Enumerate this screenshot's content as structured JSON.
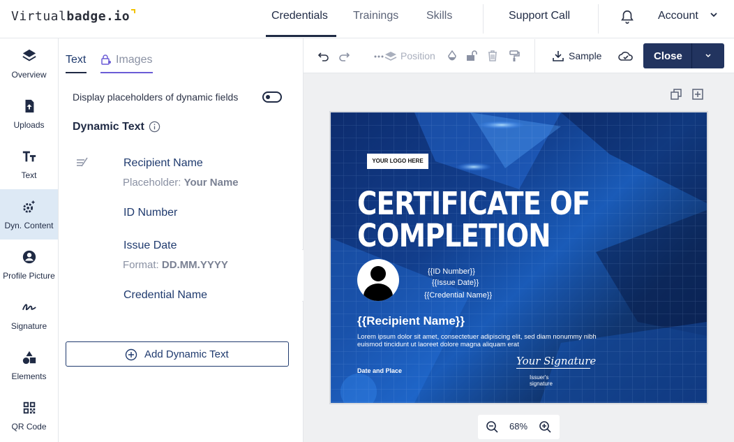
{
  "header": {
    "logo_light": "Virtual",
    "logo_bold": "badge.io",
    "nav": [
      "Credentials",
      "Trainings",
      "Skills"
    ],
    "support_label": "Support Call",
    "account_label": "Account"
  },
  "sidebar": {
    "items": [
      {
        "label": "Overview",
        "icon": "layers-icon"
      },
      {
        "label": "Uploads",
        "icon": "upload-icon"
      },
      {
        "label": "Text",
        "icon": "text-icon"
      },
      {
        "label": "Dyn. Content",
        "icon": "dynamic-content-icon"
      },
      {
        "label": "Profile Picture",
        "icon": "profile-icon"
      },
      {
        "label": "Signature",
        "icon": "signature-icon"
      },
      {
        "label": "Elements",
        "icon": "shapes-icon"
      },
      {
        "label": "QR Code",
        "icon": "qr-code-icon"
      }
    ],
    "active_index": 3
  },
  "panel": {
    "tabs": [
      "Text",
      "Images"
    ],
    "toggle_label": "Display placeholders of dynamic fields",
    "section_title": "Dynamic Text",
    "fields": [
      {
        "name": "Recipient Name",
        "sub_label": "Placeholder:",
        "sub_value": "Your Name"
      },
      {
        "name": "ID Number",
        "sub_label": "",
        "sub_value": ""
      },
      {
        "name": "Issue Date",
        "sub_label": "Format:",
        "sub_value": "DD.MM.YYYY"
      },
      {
        "name": "Credential Name",
        "sub_label": "",
        "sub_value": ""
      }
    ],
    "add_button": "Add Dynamic Text"
  },
  "toolbar": {
    "position_label": "Position",
    "sample_label": "Sample",
    "close_label": "Close"
  },
  "certificate": {
    "logo_placeholder": "YOUR LOGO HERE",
    "title_line1": "CERTIFICATE OF",
    "title_line2": "COMPLETION",
    "id_number": "{{ID Number}}",
    "issue_date": "{{Issue Date}}",
    "credential_name": "{{Credential Name}}",
    "recipient": "{{Recipient Name}}",
    "lorem": "Lorem ipsum dolor sit amet, consectetuer adipiscing elit, sed diam nonummy nibh euismod tincidunt ut laoreet dolore magna aliquam erat",
    "date_place": "Date and Place",
    "signature_script": "Your Signature",
    "issuer_label": "Issuer's signature"
  },
  "zoom": {
    "level": "68%"
  },
  "colors": {
    "primary": "#22345f",
    "active_sidebar": "#dde9f5",
    "accent_images_tab": "#6b5cd6"
  }
}
